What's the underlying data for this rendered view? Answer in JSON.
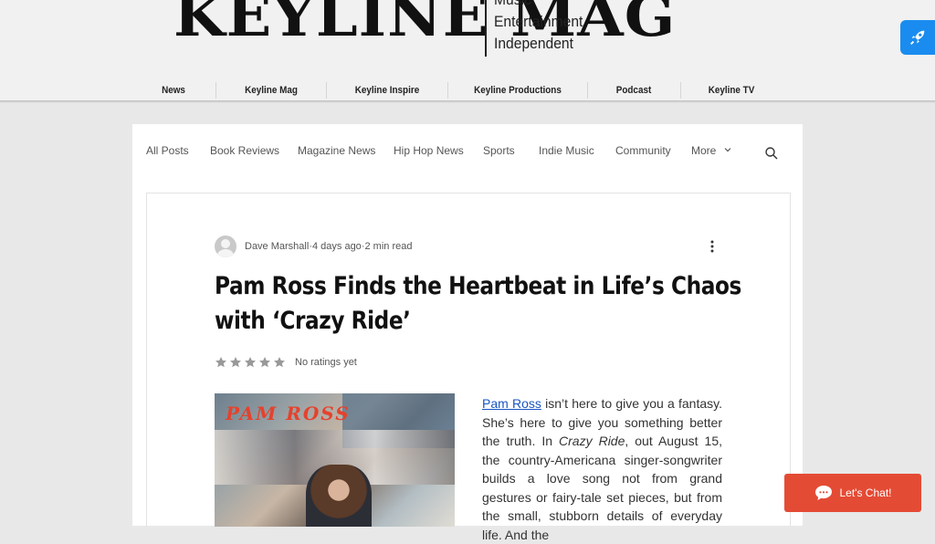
{
  "header": {
    "logo": "KEYLINE MAG",
    "tagline": [
      "Music",
      "Entertainment",
      "Independent"
    ],
    "nav": [
      "News",
      "Keyline Mag",
      "Keyline Inspire",
      "Keyline Productions",
      "Podcast",
      "Keyline TV"
    ]
  },
  "categories": [
    "All Posts",
    "Book Reviews",
    "Magazine News",
    "Hip Hop News",
    "Sports",
    "Indie Music",
    "Community",
    "More"
  ],
  "post": {
    "author": "Dave Marshall",
    "date": "4 days ago",
    "read_time": "2 min read",
    "title_line1": "Pam Ross Finds the Heartbeat in Life’s Chaos",
    "title_line2": "with ‘Crazy Ride’",
    "rating_text": "No ratings yet",
    "image_caption": "PAM ROSS",
    "body_link": "Pam Ross",
    "body_1": " isn’t here to give you a fantasy. She’s here to give you something better the truth. In ",
    "body_italic": "Crazy Ride",
    "body_2": ", out August 15, the country-Americana singer-songwriter builds a love song not from grand gestures or fairy-tale set pieces, but from the small, stubborn details of everyday life. And the"
  },
  "chat": {
    "label": "Let's Chat!"
  },
  "colors": {
    "accent": "#e44b35",
    "link": "#1a55c4",
    "rocket": "#1a8cf0"
  },
  "icons": [
    "rocket-icon",
    "search-icon",
    "more-vertical-icon",
    "star-icon",
    "chat-bubble-icon",
    "chevron-down-icon"
  ]
}
